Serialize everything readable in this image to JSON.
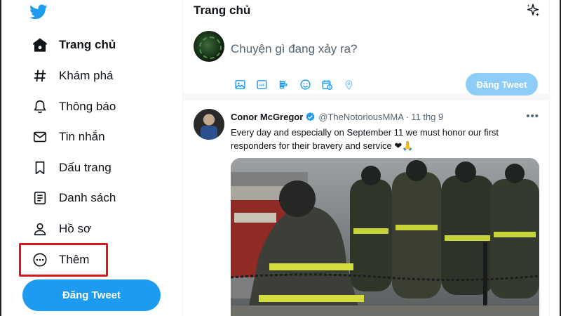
{
  "sidebar": {
    "items": [
      {
        "label": "Trang chủ",
        "icon": "home-icon"
      },
      {
        "label": "Khám phá",
        "icon": "hashtag-icon"
      },
      {
        "label": "Thông báo",
        "icon": "bell-icon"
      },
      {
        "label": "Tin nhắn",
        "icon": "envelope-icon"
      },
      {
        "label": "Dấu trang",
        "icon": "bookmark-icon"
      },
      {
        "label": "Danh sách",
        "icon": "list-icon"
      },
      {
        "label": "Hồ sơ",
        "icon": "person-icon"
      },
      {
        "label": "Thêm",
        "icon": "more-circle-icon"
      }
    ],
    "tweet_button": "Đăng Tweet"
  },
  "header": {
    "title": "Trang chủ"
  },
  "composer": {
    "placeholder": "Chuyện gì đang xảy ra?",
    "post_button": "Đăng Tweet",
    "tools": [
      "image-icon",
      "gif-icon",
      "poll-icon",
      "emoji-icon",
      "schedule-icon",
      "location-icon"
    ]
  },
  "tweet": {
    "author_name": "Conor McGregor",
    "handle": "@TheNotoriousMMA",
    "separator": "·",
    "time": "11 thg 9",
    "text": "Every day and especially on September 11 we must honor our first responders for their bravery and service",
    "emojis": "❤🙏"
  },
  "colors": {
    "accent": "#1d9bf0",
    "accent_disabled": "#8ecdf8",
    "highlight_box": "#d7191c"
  }
}
